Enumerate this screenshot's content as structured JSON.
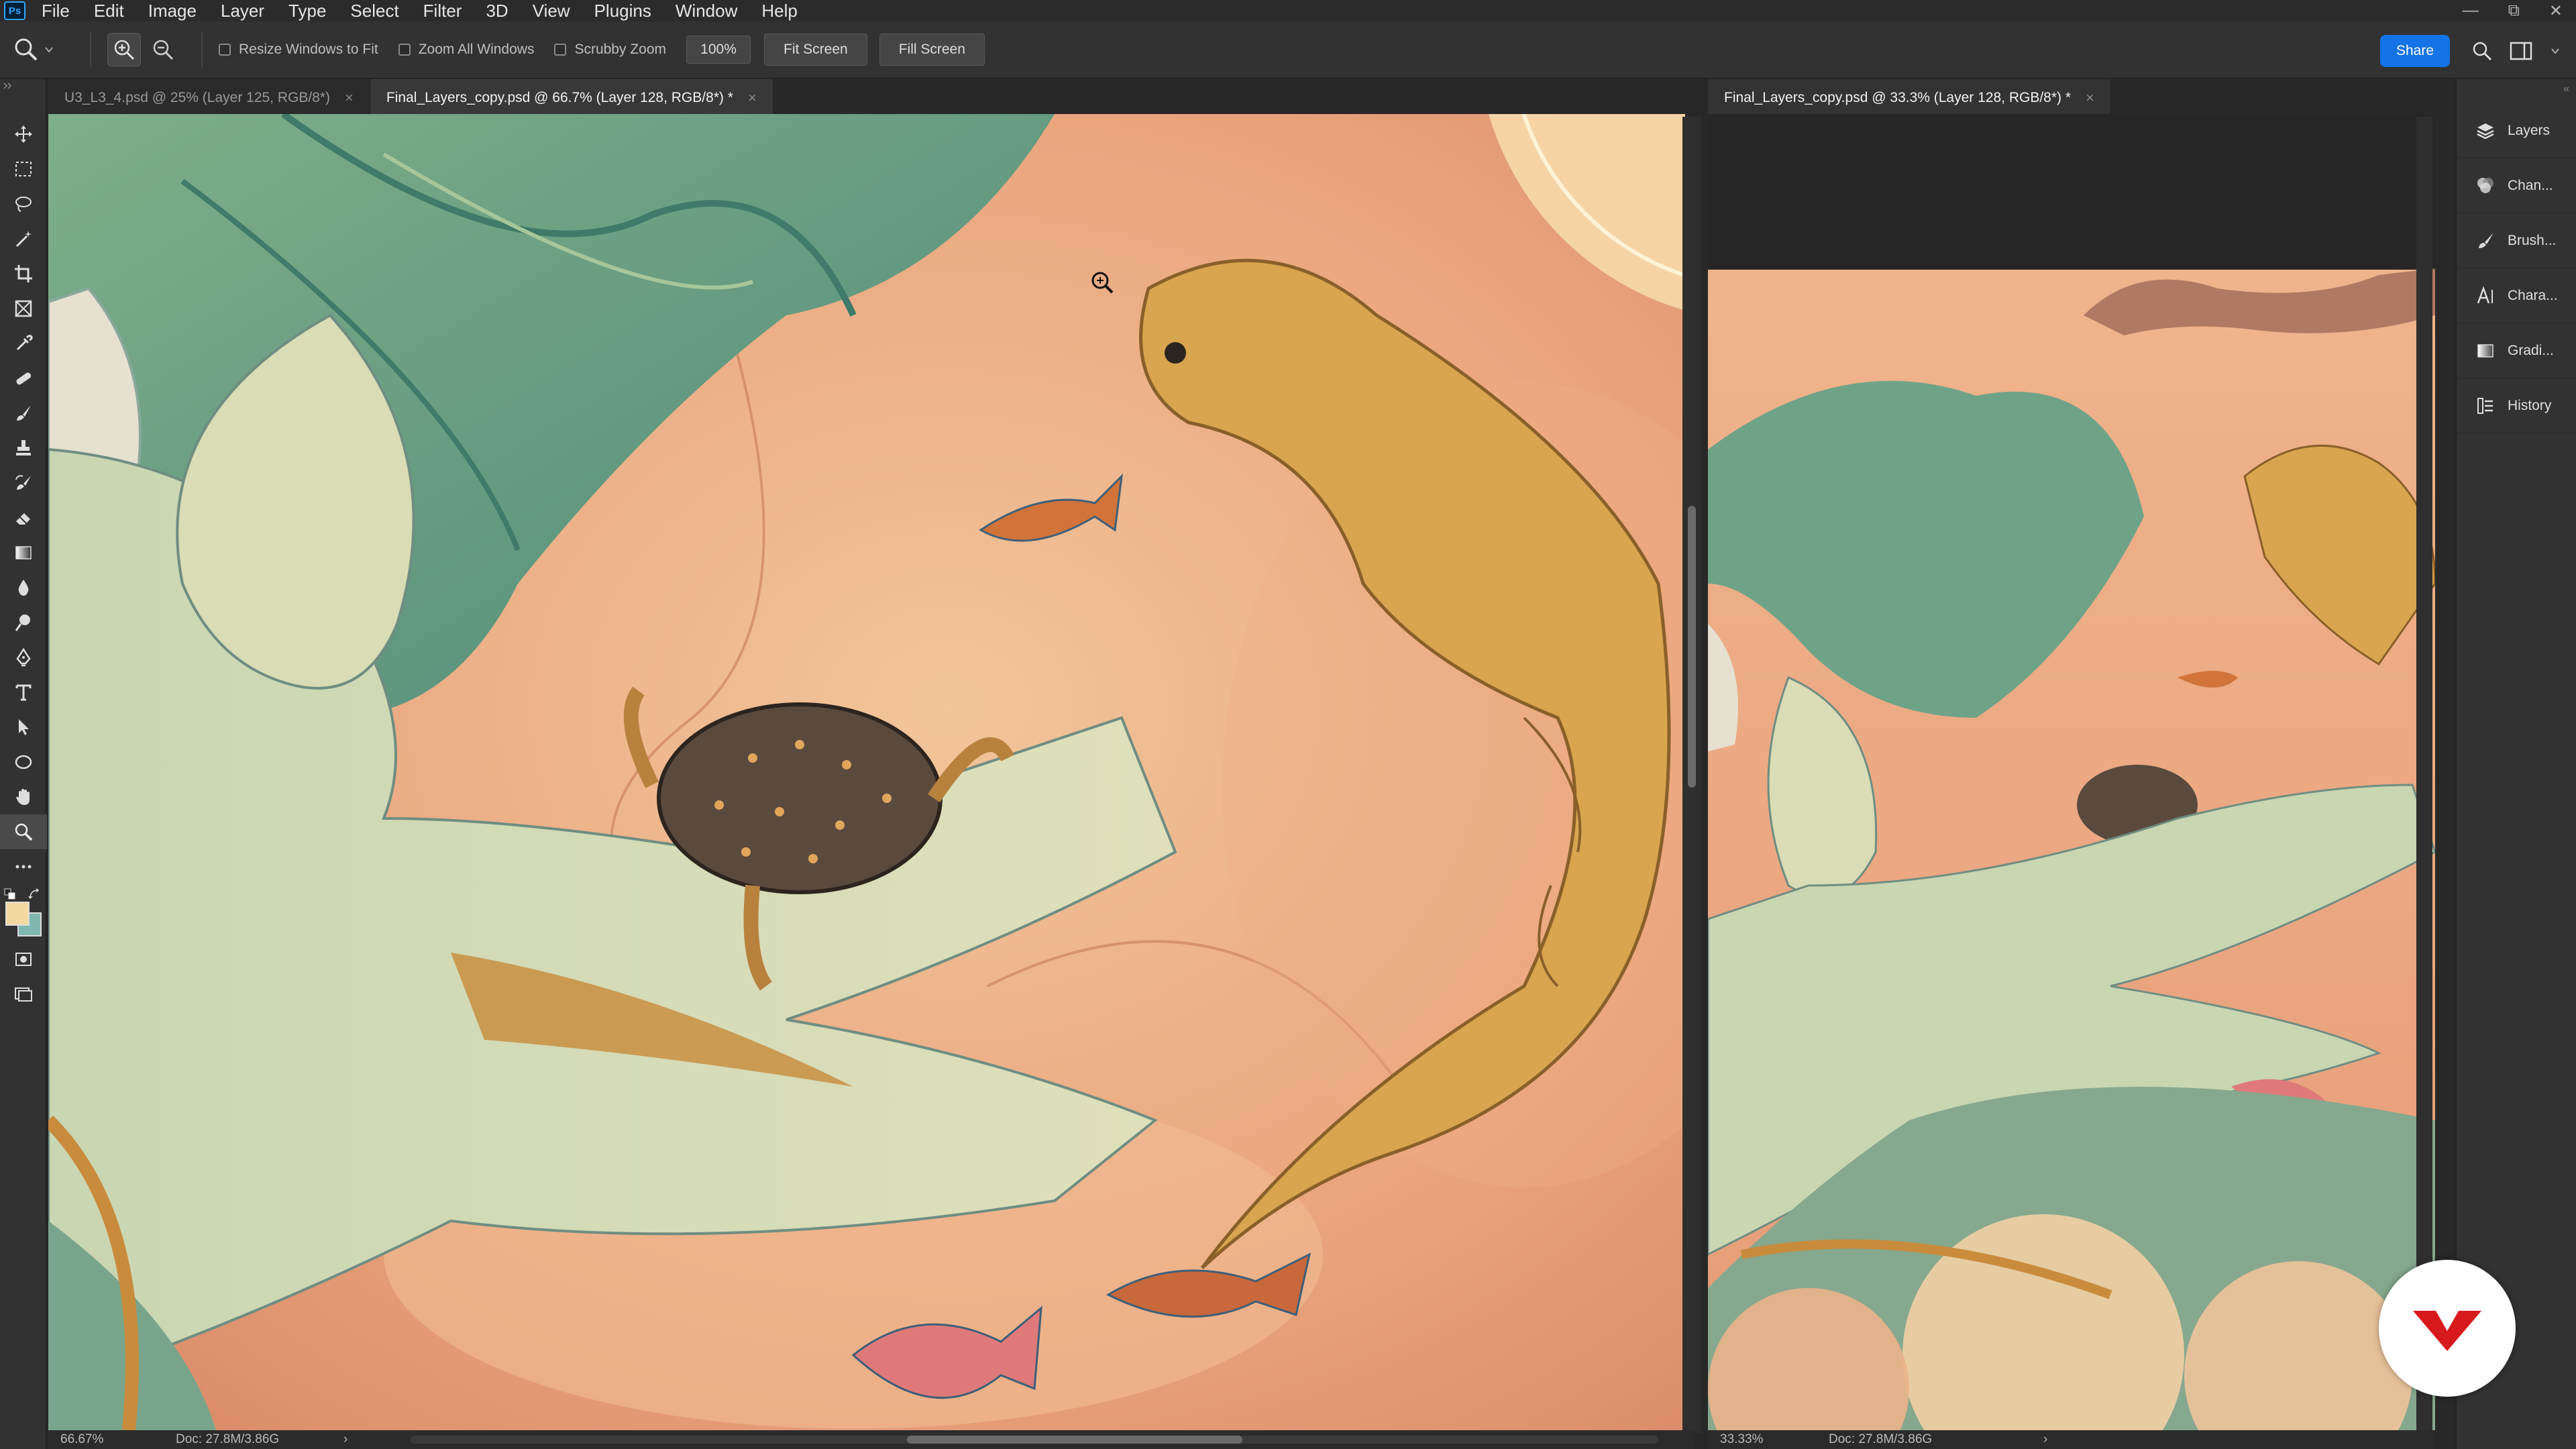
{
  "app": {
    "logo": "Ps"
  },
  "menu": [
    "File",
    "Edit",
    "Image",
    "Layer",
    "Type",
    "Select",
    "Filter",
    "3D",
    "View",
    "Plugins",
    "Window",
    "Help"
  ],
  "window_controls": [
    "minimize",
    "restore",
    "close"
  ],
  "options": {
    "tool_icon": "zoom-tool-icon",
    "checks": [
      {
        "label": "Resize Windows to Fit",
        "checked": false
      },
      {
        "label": "Zoom All Windows",
        "checked": false
      },
      {
        "label": "Scrubby Zoom",
        "checked": false
      }
    ],
    "zoom_value": "100%",
    "fit_screen": "Fit Screen",
    "fill_screen": "Fill Screen",
    "share": "Share"
  },
  "tabs_left": [
    {
      "label": "U3_L3_4.psd @ 25% (Layer 125, RGB/8*)",
      "active": false
    },
    {
      "label": "Final_Layers_copy.psd @ 66.7% (Layer 128, RGB/8*) *",
      "active": true
    }
  ],
  "tab_right": {
    "label": "Final_Layers_copy.psd @ 33.3% (Layer 128, RGB/8*) *"
  },
  "status_left": {
    "zoom": "66.67%",
    "doc": "Doc: 27.8M/3.86G"
  },
  "status_right": {
    "zoom": "33.33%",
    "doc": "Doc: 27.8M/3.86G"
  },
  "panels": [
    {
      "label": "Layers",
      "icon": "layers-icon"
    },
    {
      "label": "Chan...",
      "icon": "channels-icon"
    },
    {
      "label": "Brush...",
      "icon": "brush-icon"
    },
    {
      "label": "Chara...",
      "icon": "character-icon"
    },
    {
      "label": "Gradi...",
      "icon": "gradient-icon"
    },
    {
      "label": "History",
      "icon": "history-icon"
    }
  ],
  "tools": [
    "move",
    "marquee",
    "lasso",
    "magic-wand",
    "crop",
    "frame",
    "eyedropper",
    "healing",
    "brush",
    "stamp",
    "history-brush",
    "eraser",
    "gradient",
    "blur",
    "dodge",
    "pen",
    "type",
    "path-select",
    "ellipse",
    "hand",
    "zoom",
    "more"
  ],
  "colors": {
    "accent": "#1473e6",
    "foreground": "#f3d9a0",
    "background": "#7fb8b0",
    "brand": "#d7191c"
  }
}
